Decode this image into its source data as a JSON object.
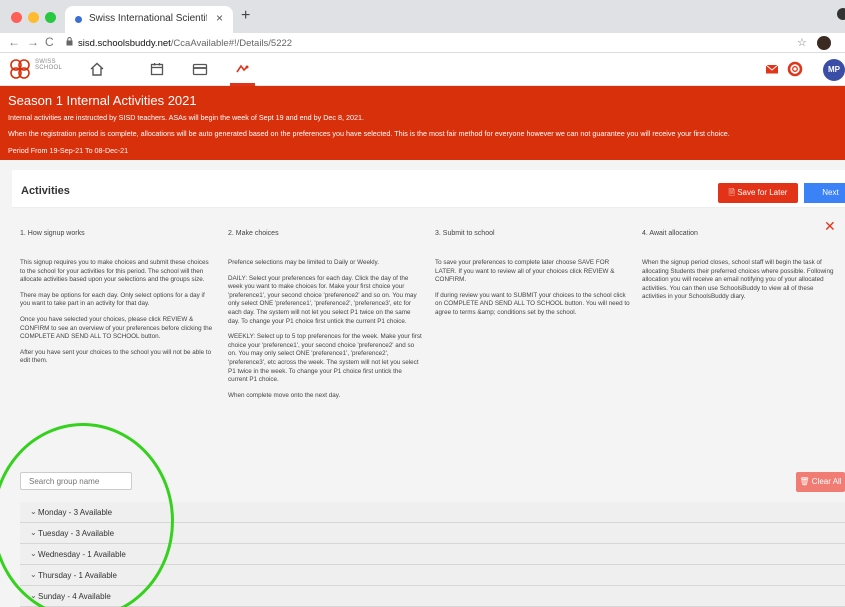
{
  "browser": {
    "tab_title": "Swiss International Scientific S",
    "url_host": "sisd.schoolsbuddy.net",
    "url_path": "/CcaAvailable#!/Details/5222"
  },
  "nav": {
    "logo_text": "SWISS SCHOOL",
    "icons": [
      "home-icon",
      "calendar-icon",
      "card-icon",
      "activity-icon"
    ],
    "right_icons": [
      "mail-icon",
      "help-icon"
    ],
    "avatar_initials": "MP",
    "accent_color": "#d9300c"
  },
  "banner": {
    "title": "Season 1 Internal Activities 2021",
    "line1": "Internal activities are instructed by SISD teachers.  ASAs will begin the week of Sept 19 and end by Dec 8, 2021.",
    "line2": "When the registration period is complete, allocations will be auto generated based on the preferences you have selected.  This is the most fair method for everyone however we can not guarantee you will receive your first choice.",
    "line3": "Period From   19-Sep-21   To   08-Dec-21"
  },
  "activities": {
    "title": "Activities",
    "save_label": "Save for Later",
    "next_label": "Next"
  },
  "steps": [
    {
      "heading": "1. How signup works",
      "paragraphs": [
        "This signup requires you to make choices and submit these choices to the school for your activities for this period. The school will then allocate activities based upon your selections and the groups size.",
        "There may be options for each day. Only select options for a day if you want to take part in an activity for that day.",
        "Once you have selected your choices, please click REVIEW & CONFIRM to see an overview of your preferences before clicking the COMPLETE AND SEND ALL TO SCHOOL button.",
        "After you have sent your choices to the school you will not be able to edit them."
      ]
    },
    {
      "heading": "2. Make choices",
      "paragraphs": [
        "Prefence selections may be limited to Daily or Weekly.",
        "DAILY: Select your preferences for each day. Click the day of the week you want to make choices for. Make your first choice your 'preference1', your second choice 'preference2' and so on. You may only select ONE 'preference1', 'preference2', 'preference3', etc for each day. The system will not let you select P1 twice on the same day. To change your P1 choice first untick the current P1 choice.",
        "WEEKLY: Select up to 5 top preferences for the week. Make your first choice your 'preference1', your second choice 'preference2' and so on. You may only select ONE 'preference1', 'preference2', 'preference3', etc across the week. The system will not let you select P1 twice in the week. To change your P1 choice first untick the current P1 choice.",
        "When complete move onto the next day."
      ]
    },
    {
      "heading": "3. Submit to school",
      "paragraphs": [
        "To save your preferences to complete later choose SAVE FOR LATER. If you want to review all of your choices click REVIEW & CONFIRM.",
        "If during review you want to SUBMIT your choices to the school click on COMPLETE AND SEND ALL TO SCHOOL button. You will need to agree to terms &amp; conditions set by the school."
      ]
    },
    {
      "heading": "4. Await allocation",
      "paragraphs": [
        "When the signup period closes, school staff will begin the task of allocating Students their preferred choices where possible. Following allocation you will receive an email notifying you of your allocated activities. You can then use SchoolsBuddy to view all of these activities in your SchoolsBuddy diary."
      ]
    }
  ],
  "search": {
    "placeholder": "Search group name"
  },
  "clear_label": "Clear All",
  "days": [
    {
      "label": "Monday - 3 Available"
    },
    {
      "label": "Tuesday - 3 Available"
    },
    {
      "label": "Wednesday - 1 Available"
    },
    {
      "label": "Thursday - 1 Available"
    },
    {
      "label": "Sunday - 4 Available"
    }
  ]
}
